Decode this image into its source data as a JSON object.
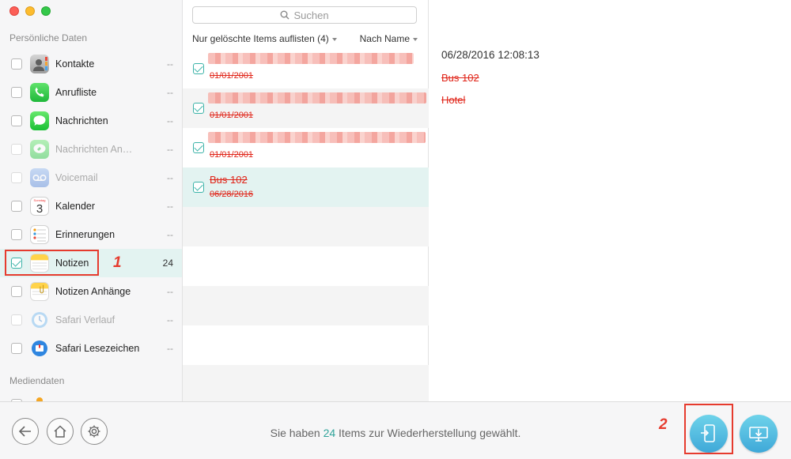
{
  "window": {
    "traffic_lights": [
      "close",
      "minimize",
      "zoom"
    ]
  },
  "sidebar": {
    "section_personal": "Persönliche Daten",
    "section_media": "Mediendaten",
    "items": [
      {
        "label": "Kontakte",
        "count": "--",
        "icon": "contacts-icon",
        "checked": false,
        "disabled": false
      },
      {
        "label": "Anrufliste",
        "count": "--",
        "icon": "phone-icon",
        "checked": false,
        "disabled": false
      },
      {
        "label": "Nachrichten",
        "count": "--",
        "icon": "messages-icon",
        "checked": false,
        "disabled": false
      },
      {
        "label": "Nachrichten An…",
        "count": "--",
        "icon": "message-attachments-icon",
        "checked": false,
        "disabled": true
      },
      {
        "label": "Voicemail",
        "count": "--",
        "icon": "voicemail-icon",
        "checked": false,
        "disabled": true
      },
      {
        "label": "Kalender",
        "count": "--",
        "icon": "calendar-icon",
        "checked": false,
        "disabled": false,
        "calendar_day_name": "Sonntag",
        "calendar_day": "3"
      },
      {
        "label": "Erinnerungen",
        "count": "--",
        "icon": "reminders-icon",
        "checked": false,
        "disabled": false
      },
      {
        "label": "Notizen",
        "count": "24",
        "icon": "notes-icon",
        "checked": true,
        "disabled": false,
        "selected": true
      },
      {
        "label": "Notizen Anhänge",
        "count": "--",
        "icon": "notes-attachments-icon",
        "checked": false,
        "disabled": false
      },
      {
        "label": "Safari Verlauf",
        "count": "--",
        "icon": "safari-history-icon",
        "checked": false,
        "disabled": true
      },
      {
        "label": "Safari Lesezeichen",
        "count": "--",
        "icon": "safari-bookmarks-icon",
        "checked": false,
        "disabled": false
      }
    ]
  },
  "annotations": {
    "step1": "1",
    "step2": "2",
    "accent": "#e63b2e"
  },
  "list": {
    "search_placeholder": "Suchen",
    "filter_label": "Nur gelöschte Items auflisten (4)",
    "sort_label": "Nach Name",
    "rows": [
      {
        "title": "",
        "date": "01/01/2001",
        "blurred": true
      },
      {
        "title": "",
        "date": "01/01/2001",
        "blurred": true
      },
      {
        "title": "",
        "date": "01/01/2001",
        "blurred": true
      },
      {
        "title": "Bus 102",
        "date": "06/28/2016",
        "blurred": false,
        "selected": true
      }
    ]
  },
  "detail": {
    "timestamp": "06/28/2016 12:08:13",
    "lines": [
      "Bus 102",
      "Hotel"
    ]
  },
  "bottom": {
    "status_prefix": "Sie haben ",
    "status_count": "24",
    "status_suffix": " Items zur Wiederherstellung gewählt.",
    "buttons": [
      "back-icon",
      "home-icon",
      "settings-icon"
    ],
    "actions": [
      "recover-to-device-icon",
      "recover-to-computer-icon"
    ]
  },
  "colors": {
    "accent_teal": "#3bb3a8",
    "deleted_red": "#e02418",
    "selection_bg": "#e3f3f1"
  }
}
